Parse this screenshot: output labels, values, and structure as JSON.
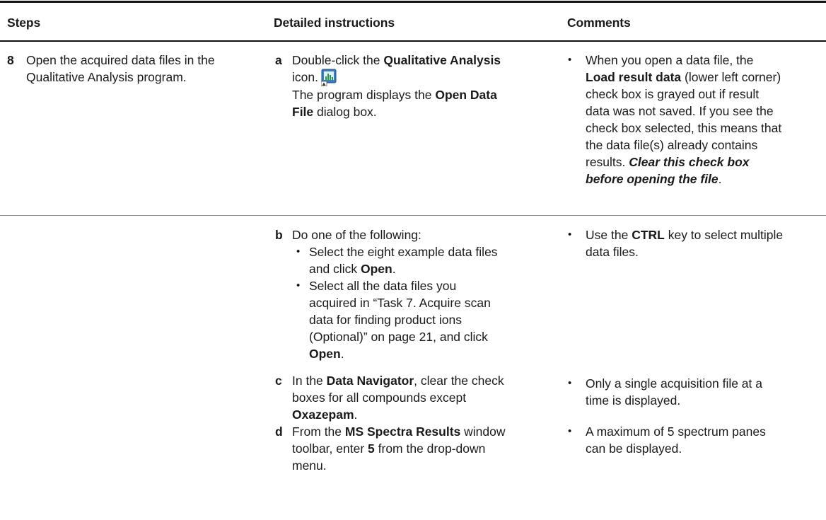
{
  "headers": {
    "steps": "Steps",
    "detailed": "Detailed instructions",
    "comments": "Comments"
  },
  "step8": {
    "number": "8",
    "text_line1": "Open the acquired data files in the",
    "text_line2": "Qualitative Analysis program."
  },
  "instr_a": {
    "marker": "a",
    "l1_pre": "Double-click the ",
    "l1_bold": "Qualitative Analysis",
    "l2_pre": "icon.",
    "icon": "qualitative-analysis-icon",
    "l3_pre": "The program displays the ",
    "l3_bold": "Open Data",
    "l4_bold": "File",
    "l4_post": " dialog box."
  },
  "comment_a": {
    "l1": "When you open a data file, the",
    "l2_bold": "Load result data",
    "l2_post": " (lower left corner)",
    "l3": "check box is grayed out if result",
    "l4": "data was not saved. If you see the",
    "l5": "check box selected, this means that",
    "l6": "the data file(s) already contains",
    "l7_pre": "results. ",
    "l7_bi": "Clear this check box",
    "l8_bi": "before opening the file",
    "l8_post": "."
  },
  "instr_b": {
    "marker": "b",
    "l1": "Do one of the following:",
    "opt1_l1": "Select the eight example data files",
    "opt1_l2_pre": "and click ",
    "opt1_l2_bold": "Open",
    "opt1_l2_post": ".",
    "opt2_l1": "Select all the data files you",
    "opt2_l2": "acquired in “Task 7. Acquire scan",
    "opt2_l3": "data for finding product ions",
    "opt2_l4": "(Optional)” on page 21, and click",
    "opt2_l5_bold": "Open",
    "opt2_l5_post": "."
  },
  "comment_b": {
    "l1_pre": "Use the ",
    "l1_bold": "CTRL",
    "l1_post": " key to select multiple",
    "l2": "data files."
  },
  "instr_c": {
    "marker": "c",
    "l1_pre": "In the ",
    "l1_bold": "Data Navigator",
    "l1_post": ", clear the check",
    "l2": "boxes for all compounds except",
    "l3_bold": "Oxazepam",
    "l3_post": "."
  },
  "comment_c": {
    "l1": "Only a single acquisition file at a",
    "l2": "time is displayed."
  },
  "instr_d": {
    "marker": "d",
    "l1_pre": "From the ",
    "l1_bold": "MS Spectra Results",
    "l1_post": " window",
    "l2_pre": "toolbar, enter ",
    "l2_bold": "5",
    "l2_post": " from the drop-down",
    "l3": "menu."
  },
  "comment_d": {
    "l1": "A maximum of 5 spectrum panes",
    "l2": "can be displayed."
  },
  "bullet_char": "•"
}
